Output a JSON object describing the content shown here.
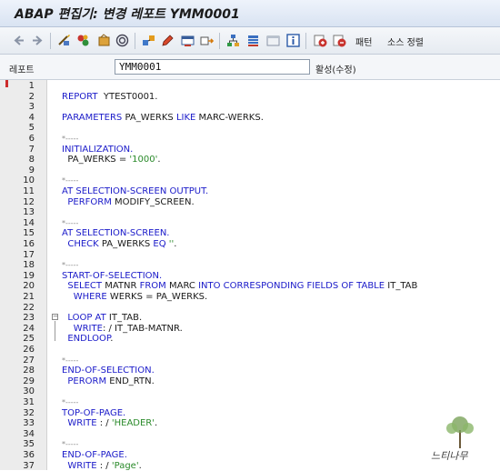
{
  "window": {
    "title": "ABAP 편집기: 변경 레포트 YMM0001"
  },
  "toolbar": {
    "icons": [
      "back-arrow-icon",
      "forward-arrow-icon",
      "toggle-display-change-icon",
      "other-object-icon",
      "activate-icon",
      "test-icon",
      "where-used-icon",
      "object-list-icon",
      "display-object-icon",
      "edit-pencil-icon",
      "inspect-icon",
      "navigation-window-icon",
      "hierarchy-icon",
      "layout-icon",
      "help-info-icon",
      "insert-statement-icon",
      "delete-statement-icon"
    ],
    "pattern_label": "패턴",
    "pretty_print_label": "소스 정렬"
  },
  "report_field": {
    "label": "레포트",
    "value": "YMM0001",
    "status": "활성(수정)"
  },
  "code_lines": [
    {
      "n": "1",
      "parts": []
    },
    {
      "n": "2",
      "parts": [
        {
          "t": "REPORT  YTEST0001.",
          "c": "kw-mixed"
        }
      ]
    },
    {
      "n": "3",
      "parts": []
    },
    {
      "n": "4",
      "parts": [
        {
          "t": "PARAMETERS PA_WERKS LIKE MARC-WERKS.",
          "c": ""
        }
      ]
    },
    {
      "n": "5",
      "parts": []
    },
    {
      "n": "6",
      "parts": [
        {
          "t": "*-----",
          "c": "cmt"
        }
      ]
    },
    {
      "n": "7",
      "parts": [
        {
          "t": "INITIALIZATION.",
          "c": "kw"
        }
      ]
    },
    {
      "n": "8",
      "parts": [
        {
          "t": "  PA_WERKS = '1000'.",
          "c": ""
        }
      ]
    },
    {
      "n": "9",
      "parts": []
    },
    {
      "n": "10",
      "parts": [
        {
          "t": "*-----",
          "c": "cmt"
        }
      ]
    },
    {
      "n": "11",
      "parts": [
        {
          "t": "AT SELECTION-SCREEN OUTPUT.",
          "c": "kw"
        }
      ]
    },
    {
      "n": "12",
      "parts": [
        {
          "t": "  PERFORM MODIFY_SCREEN.",
          "c": ""
        }
      ]
    },
    {
      "n": "13",
      "parts": []
    },
    {
      "n": "14",
      "parts": [
        {
          "t": "*-----",
          "c": "cmt"
        }
      ]
    },
    {
      "n": "15",
      "parts": [
        {
          "t": "AT SELECTION-SCREEN.",
          "c": "kw"
        }
      ]
    },
    {
      "n": "16",
      "parts": [
        {
          "t": "  CHECK PA_WERKS EQ ''.",
          "c": ""
        }
      ]
    },
    {
      "n": "17",
      "parts": []
    },
    {
      "n": "18",
      "parts": [
        {
          "t": "*-----",
          "c": "cmt"
        }
      ]
    },
    {
      "n": "19",
      "parts": [
        {
          "t": "START-OF-SELECTION.",
          "c": "kw"
        }
      ]
    },
    {
      "n": "20",
      "parts": [
        {
          "t": "  SELECT MATNR FROM MARC INTO CORRESPONDING FIELDS OF TABLE IT_TAB",
          "c": ""
        }
      ]
    },
    {
      "n": "21",
      "parts": [
        {
          "t": "    WHERE WERKS = PA_WERKS.",
          "c": ""
        }
      ]
    },
    {
      "n": "22",
      "parts": []
    },
    {
      "n": "23",
      "parts": [
        {
          "t": "  LOOP AT IT_TAB.",
          "c": ""
        }
      ]
    },
    {
      "n": "24",
      "parts": [
        {
          "t": "    WRITE: / IT_TAB-MATNR.",
          "c": ""
        }
      ]
    },
    {
      "n": "25",
      "parts": [
        {
          "t": "  ENDLOOP.",
          "c": ""
        }
      ]
    },
    {
      "n": "26",
      "parts": []
    },
    {
      "n": "27",
      "parts": [
        {
          "t": "*-----",
          "c": "cmt"
        }
      ]
    },
    {
      "n": "28",
      "parts": [
        {
          "t": "END-OF-SELECTION.",
          "c": "kw"
        }
      ]
    },
    {
      "n": "29",
      "parts": [
        {
          "t": "  PERORM END_RTN.",
          "c": ""
        }
      ]
    },
    {
      "n": "30",
      "parts": []
    },
    {
      "n": "31",
      "parts": [
        {
          "t": "*-----",
          "c": "cmt"
        }
      ]
    },
    {
      "n": "32",
      "parts": [
        {
          "t": "TOP-OF-PAGE.",
          "c": "kw"
        }
      ]
    },
    {
      "n": "33",
      "parts": [
        {
          "t": "  WRITE : / 'HEADER'.",
          "c": ""
        }
      ]
    },
    {
      "n": "34",
      "parts": []
    },
    {
      "n": "35",
      "parts": [
        {
          "t": "*-----",
          "c": "cmt"
        }
      ]
    },
    {
      "n": "36",
      "parts": [
        {
          "t": "END-OF-PAGE.",
          "c": "kw"
        }
      ]
    },
    {
      "n": "37",
      "parts": [
        {
          "t": "  WRITE : / 'Page'.",
          "c": ""
        }
      ]
    }
  ],
  "watermark": {
    "text": "느티나무"
  },
  "colors": {
    "keyword": "#1a1ac9",
    "string": "#2a8a2a",
    "comment": "#8a8a8a",
    "line_number_bg": "#ececec"
  }
}
